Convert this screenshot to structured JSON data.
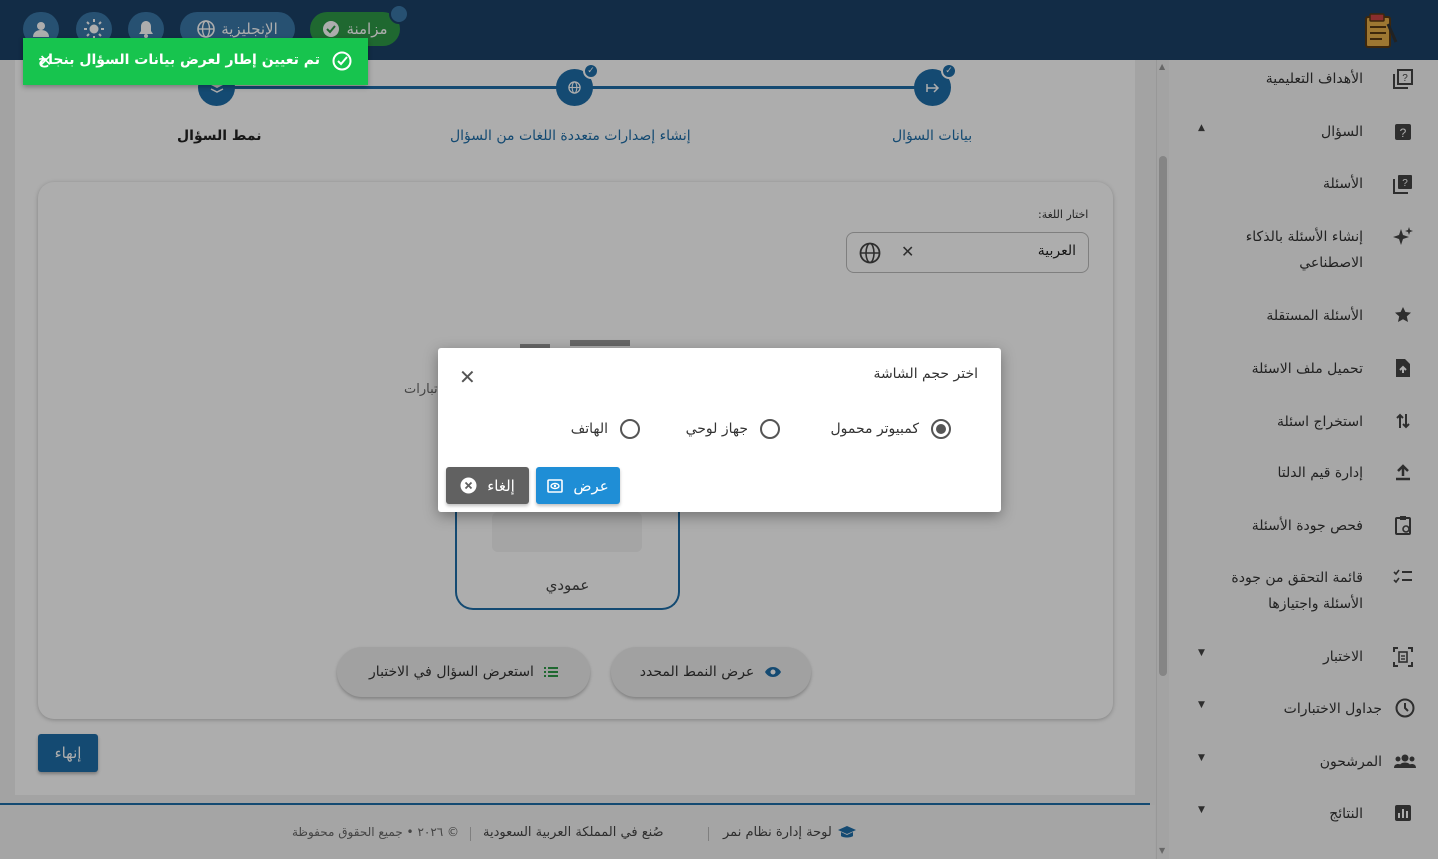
{
  "header": {
    "sync_label": "مزامنة",
    "language_label": "الإنجليزية"
  },
  "sidebar": {
    "items": [
      {
        "label": "الأهداف التعليمية",
        "icon": "objectives-icon"
      },
      {
        "label": "السؤال",
        "icon": "question-box-icon",
        "caret": "▲"
      },
      {
        "label": "الأسئلة",
        "icon": "questions-icon"
      },
      {
        "label": "إنشاء الأسئلة بالذكاء الاصطناعي",
        "icon": "sparkle-icon"
      },
      {
        "label": "الأسئلة المستقلة",
        "icon": "star-icon"
      },
      {
        "label": "تحميل ملف الاسئلة",
        "icon": "file-upload-icon"
      },
      {
        "label": "استخراج اسئلة",
        "icon": "swap-icon"
      },
      {
        "label": "إدارة قيم الدلتا",
        "icon": "upload-icon"
      },
      {
        "label": "فحص جودة الأسئلة",
        "icon": "clipboard-icon"
      },
      {
        "label": "قائمة التحقق من جودة الأسئلة واجتيازها",
        "icon": "checklist-icon"
      },
      {
        "label": "الاختبار",
        "icon": "exam-icon",
        "caret": "▼"
      },
      {
        "label": "جداول الاختبارات",
        "icon": "clock-icon",
        "caret": "▼"
      },
      {
        "label": "المرشحون",
        "icon": "people-icon",
        "caret": "▼"
      },
      {
        "label": "النتائج",
        "icon": "chart-icon",
        "caret": "▼"
      }
    ]
  },
  "stepper": {
    "steps": [
      {
        "label": "بيانات السؤال"
      },
      {
        "label": "إنشاء إصدارات متعددة اللغات من السؤال"
      },
      {
        "label": "نمط السؤال"
      }
    ]
  },
  "form": {
    "language_label": "اختار اللغة:",
    "language_value": "العربية",
    "partial_text": "تبارات",
    "option_label": "عمودي",
    "preview_in_exam_label": "استعرض السؤال في الاختبار",
    "view_selected_style_label": "عرض النمط المحدد",
    "finish_label": "إنهاء"
  },
  "footer": {
    "dashboard_label": "لوحة إدارة نظام نمر",
    "made_in": "صُنع في المملكة العربية السعودية",
    "copyright": "© ٢٠٢٦ • جميع الحقوق محفوظة"
  },
  "toast": {
    "message": "تم تعيين إطار لعرض بيانات السؤال بنجاح"
  },
  "modal": {
    "title": "اختر حجم الشاشة",
    "options": [
      {
        "label": "كمبيوتر محمول",
        "checked": true
      },
      {
        "label": "جهاز لوحي",
        "checked": false
      },
      {
        "label": "الهاتف",
        "checked": false
      }
    ],
    "view_label": "عرض",
    "cancel_label": "إلغاء"
  },
  "colors": {
    "header_bg": "#1b4268",
    "primary": "#1e6ea8",
    "toast_green": "#17c44e",
    "sync_green": "#2e9a48",
    "view_button": "#1f8ed6",
    "cancel_button": "#616161"
  }
}
